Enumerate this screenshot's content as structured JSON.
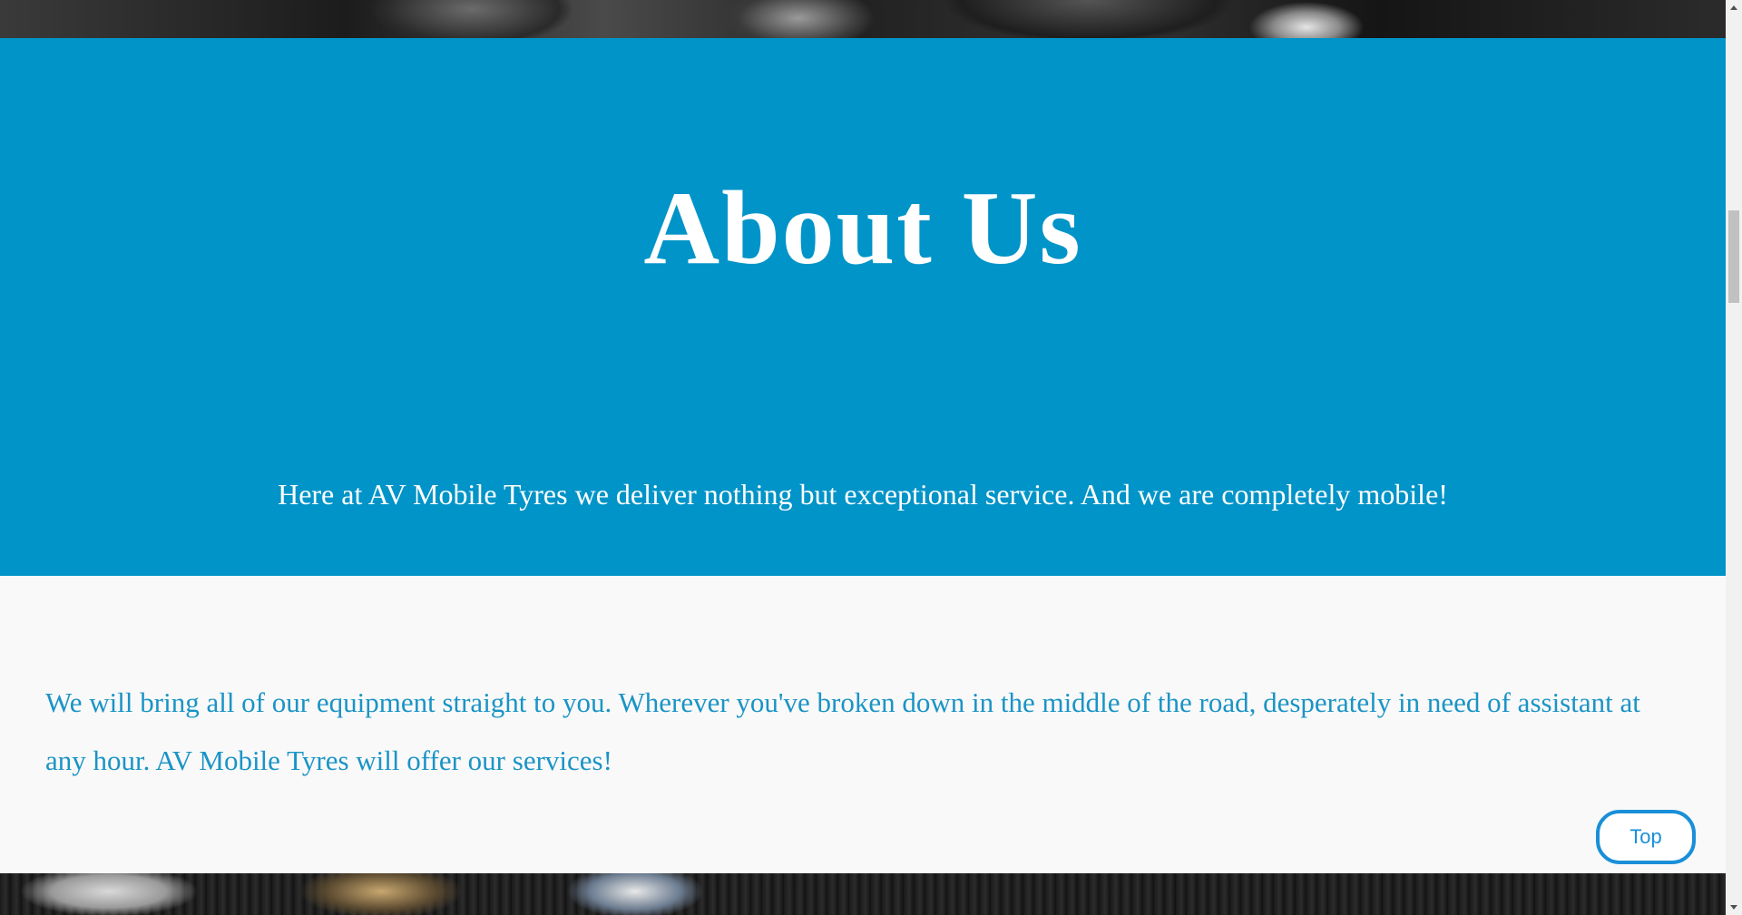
{
  "about": {
    "title": "About Us",
    "lead": "Here at AV Mobile Tyres we deliver nothing but exceptional service. And we are completely mobile!"
  },
  "body": {
    "text": "We will bring all of our equipment straight to you. Wherever you've broken down in the middle of the road, desperately in need of assistant at any hour. AV Mobile Tyres will offer our services!"
  },
  "top_button": {
    "label": "Top"
  },
  "colors": {
    "about_background": "#0094c8",
    "body_text": "#1a94c6",
    "top_button_border": "#1a8fd8"
  }
}
